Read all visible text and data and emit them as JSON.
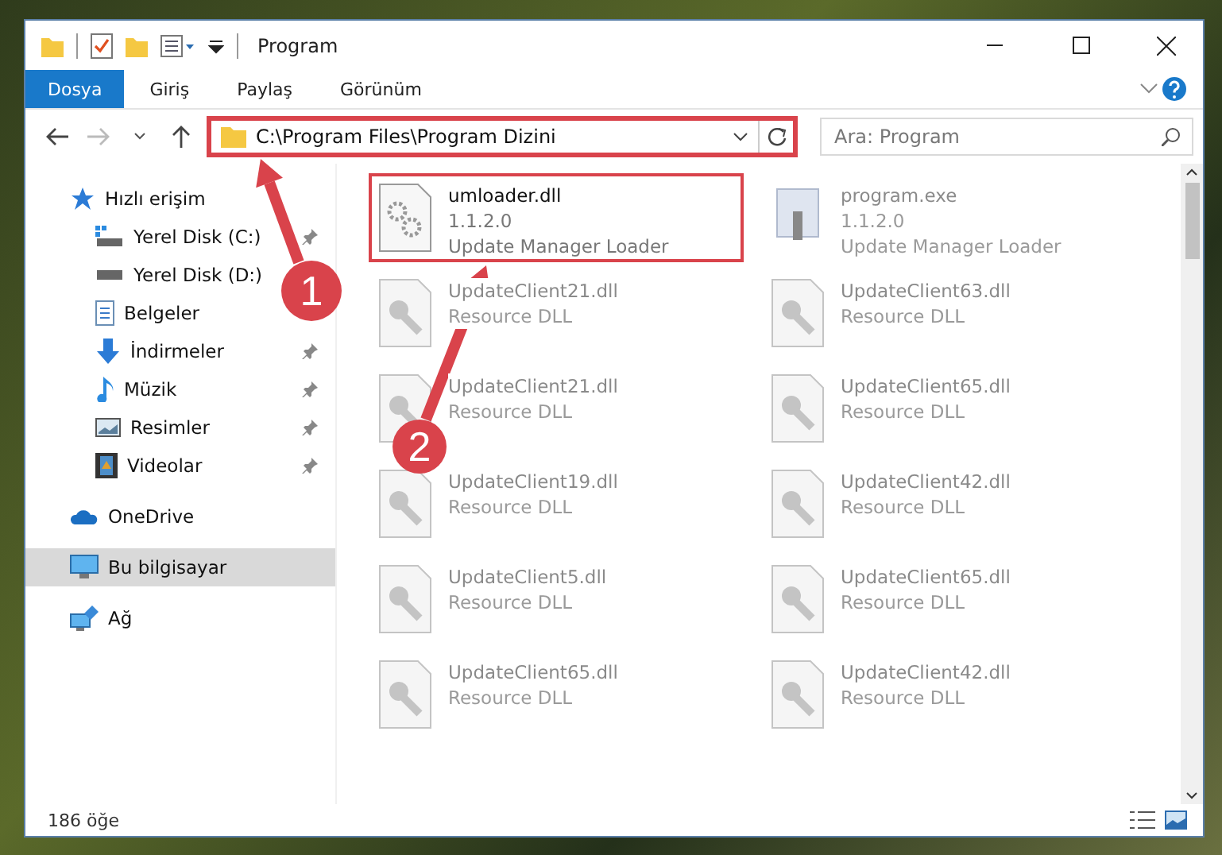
{
  "window": {
    "title": "Program"
  },
  "ribbon_tabs": [
    {
      "label": "Dosya",
      "selected": true
    },
    {
      "label": "Giriş",
      "selected": false
    },
    {
      "label": "Paylaş",
      "selected": false
    },
    {
      "label": "Görünüm",
      "selected": false
    }
  ],
  "address_bar": {
    "path": "C:\\Program Files\\Program Dizini",
    "highlighted": true
  },
  "search": {
    "placeholder": "Ara: Program"
  },
  "sidebar": {
    "items": [
      {
        "label": "Hızlı erişim",
        "kind": "star",
        "selected": false,
        "children": [
          {
            "label": "Yerel Disk (C:)",
            "kind": "disk-c",
            "pinned": true,
            "selected": false
          },
          {
            "label": "Yerel Disk (D:)",
            "kind": "disk",
            "pinned": false,
            "selected": false
          },
          {
            "label": "Belgeler",
            "kind": "doc",
            "pinned": false,
            "selected": false
          },
          {
            "label": "İndirmeler",
            "kind": "download",
            "pinned": true,
            "selected": false
          },
          {
            "label": "Müzik",
            "kind": "music",
            "pinned": true,
            "selected": false
          },
          {
            "label": "Resimler",
            "kind": "pictures",
            "pinned": true,
            "selected": false
          },
          {
            "label": "Videolar",
            "kind": "video",
            "pinned": true,
            "selected": false
          }
        ]
      },
      {
        "label": "OneDrive",
        "kind": "cloud",
        "selected": false
      },
      {
        "label": "Bu bilgisayar",
        "kind": "pc",
        "selected": true
      },
      {
        "label": "Ağ",
        "kind": "network",
        "selected": false
      }
    ]
  },
  "files": [
    {
      "name": "umloader.dll",
      "version": "1.1.2.0",
      "description": "Update Manager Loader",
      "kind": "dll",
      "dimmed": false,
      "highlighted": true
    },
    {
      "name": "program.exe",
      "version": "1.1.2.0",
      "description": "Update Manager Loader",
      "kind": "exe",
      "dimmed": true,
      "highlighted": false
    },
    {
      "name": "UpdateClient21.dll",
      "description": "Resource DLL",
      "kind": "resource",
      "dimmed": true,
      "highlighted": false
    },
    {
      "name": "UpdateClient63.dll",
      "description": "Resource DLL",
      "kind": "resource",
      "dimmed": true,
      "highlighted": false
    },
    {
      "name": "UpdateClient21.dll",
      "description": "Resource DLL",
      "kind": "resource",
      "dimmed": true,
      "highlighted": false
    },
    {
      "name": "UpdateClient65.dll",
      "description": "Resource DLL",
      "kind": "resource",
      "dimmed": true,
      "highlighted": false
    },
    {
      "name": "UpdateClient19.dll",
      "description": "Resource DLL",
      "kind": "resource",
      "dimmed": true,
      "highlighted": false
    },
    {
      "name": "UpdateClient42.dll",
      "description": "Resource DLL",
      "kind": "resource",
      "dimmed": true,
      "highlighted": false
    },
    {
      "name": "UpdateClient5.dll",
      "description": "Resource DLL",
      "kind": "resource",
      "dimmed": true,
      "highlighted": false
    },
    {
      "name": "UpdateClient65.dll",
      "description": "Resource DLL",
      "kind": "resource",
      "dimmed": true,
      "highlighted": false
    },
    {
      "name": "UpdateClient65.dll",
      "description": "Resource DLL",
      "kind": "resource",
      "dimmed": true,
      "highlighted": false
    },
    {
      "name": "UpdateClient42.dll",
      "description": "Resource DLL",
      "kind": "resource",
      "dimmed": true,
      "highlighted": false
    }
  ],
  "status_bar": {
    "count": "186 öğe"
  },
  "annotations": [
    {
      "number": "1"
    },
    {
      "number": "2"
    }
  ]
}
